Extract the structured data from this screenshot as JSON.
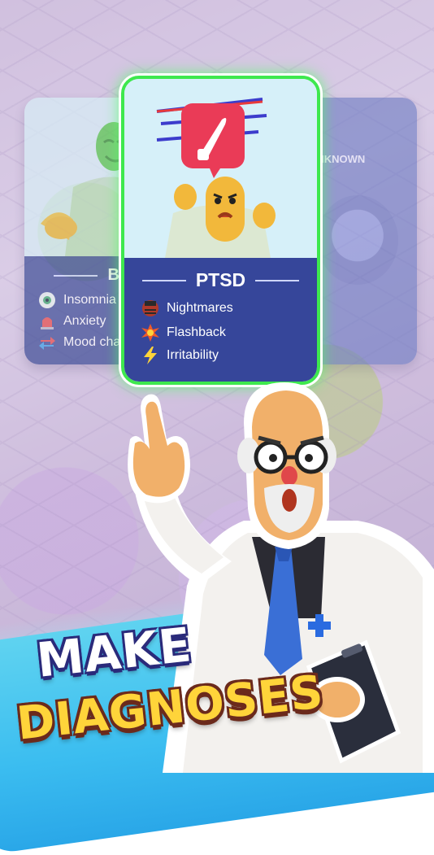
{
  "cards": {
    "left": {
      "title": "BIPOL",
      "symptoms": [
        {
          "label": "Insomnia",
          "icon": "eye-icon"
        },
        {
          "label": "Anxiety",
          "icon": "siren-icon"
        },
        {
          "label": "Mood char",
          "icon": "swap-arrows-icon"
        }
      ]
    },
    "center": {
      "title": "PTSD",
      "symptoms": [
        {
          "label": "Nightmares",
          "icon": "nightmare-face-icon"
        },
        {
          "label": "Flashback",
          "icon": "explosion-icon"
        },
        {
          "label": "Irritability",
          "icon": "lightning-icon"
        }
      ]
    },
    "right": {
      "title": "UNKNOWN"
    }
  },
  "banner": {
    "line1": "MAKE",
    "line2": "DIAGNOSES"
  },
  "colors": {
    "highlight": "#3ee84e",
    "panel": "#36469a",
    "banner_yellow": "#ffd43a",
    "wave_blue": "#3bbdf0"
  }
}
